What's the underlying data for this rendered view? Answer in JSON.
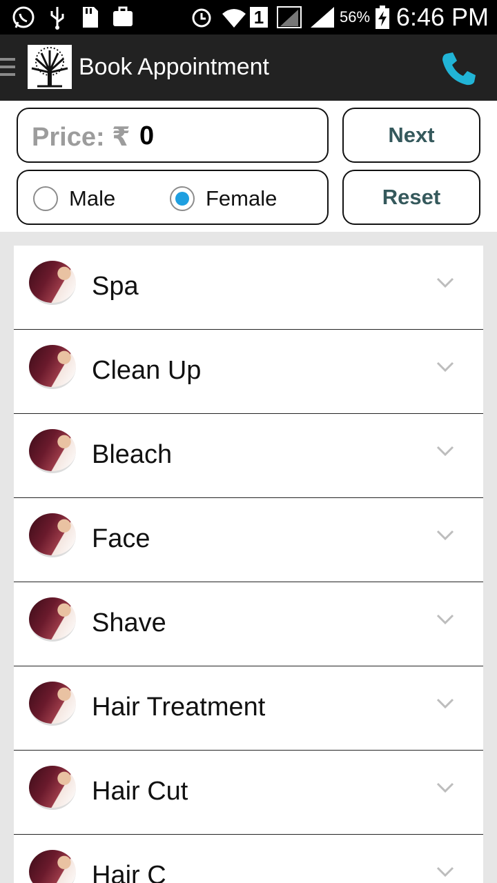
{
  "status_bar": {
    "battery": "56%",
    "time": "6:46 PM",
    "sim_slot": "1",
    "icons": [
      "whatsapp-icon",
      "usb-icon",
      "sd-card-icon",
      "bag-icon",
      "alarm-icon",
      "wifi-icon",
      "signal-icon",
      "battery-charging-icon"
    ]
  },
  "app_bar": {
    "title": "Book Appointment",
    "logo": "tree-logo",
    "call_icon": "phone-icon",
    "accent": "#21b4d6"
  },
  "price": {
    "label": "Price: ₹",
    "value": "0"
  },
  "gender": {
    "male_label": "Male",
    "female_label": "Female",
    "selected": "Female",
    "selected_color": "#1e9fe0"
  },
  "buttons": {
    "next": "Next",
    "reset": "Reset",
    "text_color": "#35595c"
  },
  "categories": [
    {
      "label": "Spa"
    },
    {
      "label": "Clean Up"
    },
    {
      "label": "Bleach"
    },
    {
      "label": "Face"
    },
    {
      "label": "Shave"
    },
    {
      "label": "Hair Treatment"
    },
    {
      "label": "Hair Cut"
    },
    {
      "label": "Hair C"
    }
  ]
}
